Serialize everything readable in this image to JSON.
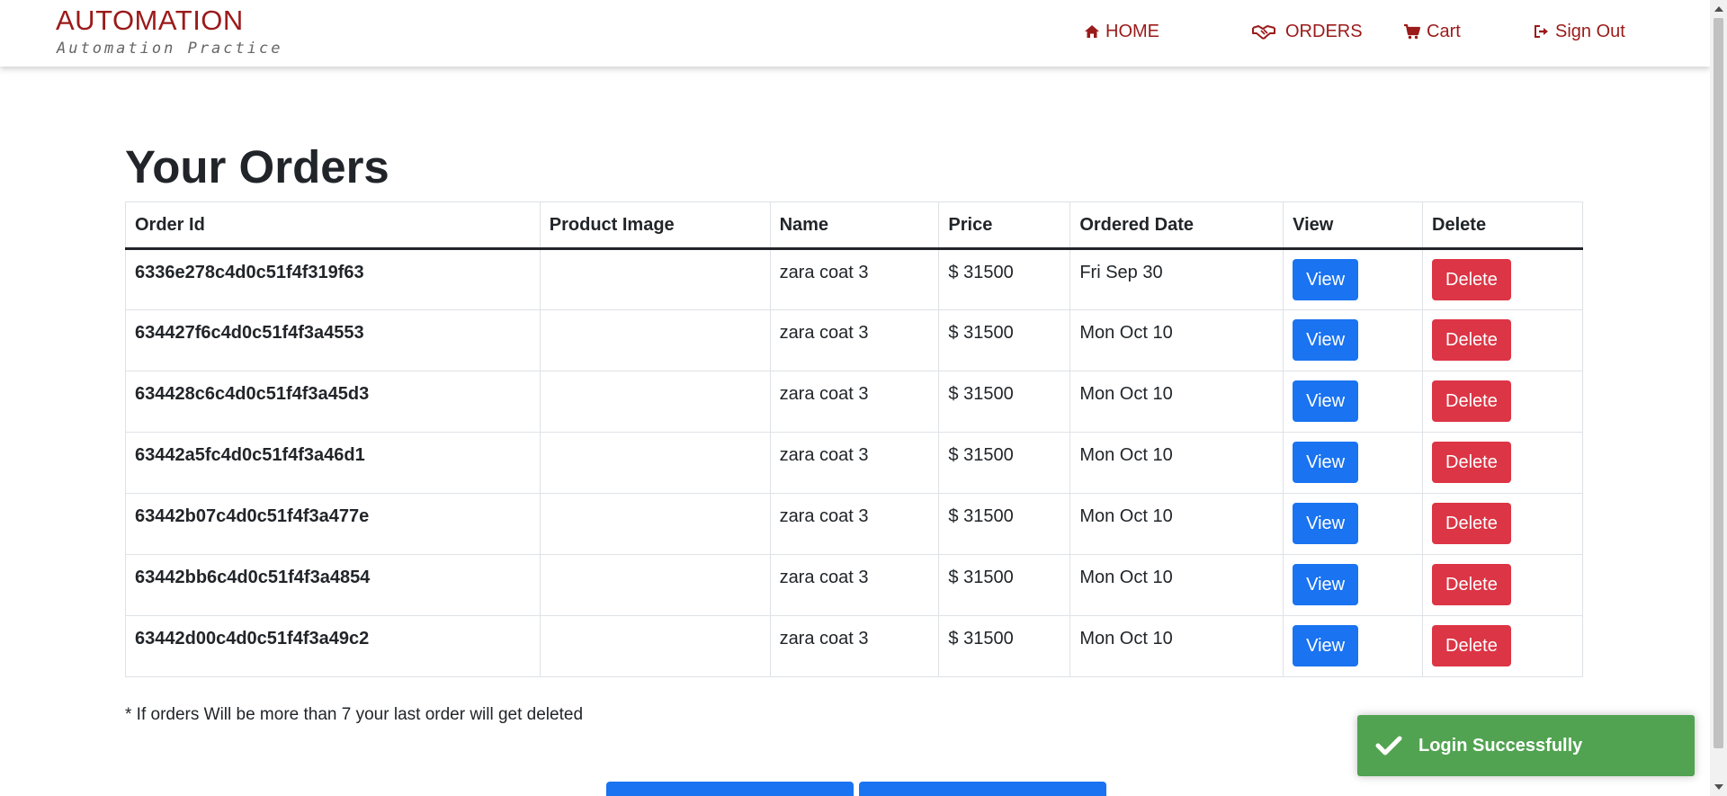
{
  "header": {
    "brand_title": "AUTOMATION",
    "brand_subtitle": "Automation Practice",
    "nav": {
      "home": "HOME",
      "orders": "ORDERS",
      "cart": "Cart",
      "sign_out": "Sign Out"
    }
  },
  "main": {
    "title": "Your Orders",
    "columns": [
      "Order Id",
      "Product Image",
      "Name",
      "Price",
      "Ordered Date",
      "View",
      "Delete"
    ],
    "rows": [
      {
        "order_id": "6336e278c4d0c51f4f319f63",
        "name": "zara coat 3",
        "price": "$ 31500",
        "date": "Fri Sep 30",
        "view": "View",
        "delete": "Delete"
      },
      {
        "order_id": "634427f6c4d0c51f4f3a4553",
        "name": "zara coat 3",
        "price": "$ 31500",
        "date": "Mon Oct 10",
        "view": "View",
        "delete": "Delete"
      },
      {
        "order_id": "634428c6c4d0c51f4f3a45d3",
        "name": "zara coat 3",
        "price": "$ 31500",
        "date": "Mon Oct 10",
        "view": "View",
        "delete": "Delete"
      },
      {
        "order_id": "63442a5fc4d0c51f4f3a46d1",
        "name": "zara coat 3",
        "price": "$ 31500",
        "date": "Mon Oct 10",
        "view": "View",
        "delete": "Delete"
      },
      {
        "order_id": "63442b07c4d0c51f4f3a477e",
        "name": "zara coat 3",
        "price": "$ 31500",
        "date": "Mon Oct 10",
        "view": "View",
        "delete": "Delete"
      },
      {
        "order_id": "63442bb6c4d0c51f4f3a4854",
        "name": "zara coat 3",
        "price": "$ 31500",
        "date": "Mon Oct 10",
        "view": "View",
        "delete": "Delete"
      },
      {
        "order_id": "63442d00c4d0c51f4f3a49c2",
        "name": "zara coat 3",
        "price": "$ 31500",
        "date": "Mon Oct 10",
        "view": "View",
        "delete": "Delete"
      }
    ],
    "note": "* If orders Will be more than 7 your last order will get deleted"
  },
  "toast": {
    "message": "Login Successfully"
  },
  "colors": {
    "brand": "#9b1a1a",
    "view_button": "#1a73f0",
    "delete_button": "#dc3545",
    "toast_success": "#51a351"
  },
  "icons": {
    "home": "home-icon",
    "orders": "handshake-icon",
    "cart": "cart-icon",
    "sign_out": "sign-out-icon",
    "toast": "checkmark-icon"
  }
}
